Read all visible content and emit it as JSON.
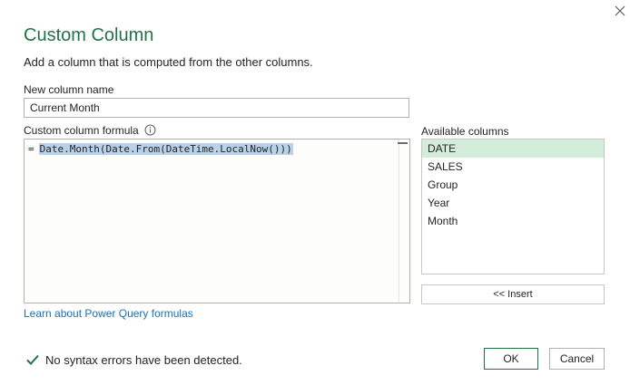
{
  "dialog": {
    "title": "Custom Column",
    "subtitle": "Add a column that is computed from the other columns.",
    "accent_color": "#217346"
  },
  "new_column": {
    "label": "New column name",
    "value": "Current Month"
  },
  "formula": {
    "label": "Custom column formula",
    "prefix": "=",
    "text": "Date.Month(Date.From(DateTime.LocalNow()))",
    "selection_color": "#b9d1ea"
  },
  "available_columns": {
    "label": "Available columns",
    "items": [
      "DATE",
      "SALES",
      "Group",
      "Year",
      "Month"
    ],
    "selected_index": 0,
    "selected_color": "#d4edd9"
  },
  "insert_button": "<< Insert",
  "learn_link": "Learn about Power Query formulas",
  "status": {
    "icon": "checkmark-icon",
    "text": "No syntax errors have been detected.",
    "color": "#217346"
  },
  "buttons": {
    "ok": "OK",
    "cancel": "Cancel"
  }
}
